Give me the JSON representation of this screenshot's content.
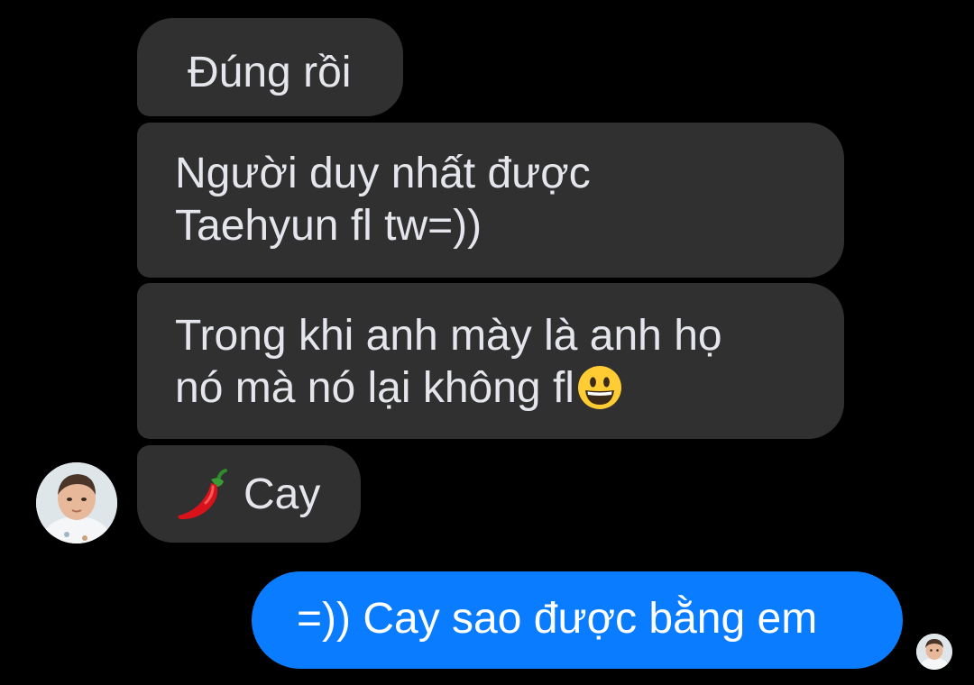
{
  "conversation": {
    "messages": [
      {
        "sender": "other",
        "text": "Đúng rồi"
      },
      {
        "sender": "other",
        "lines": [
          "Người duy nhất được",
          "Taehyun fl tw=))"
        ]
      },
      {
        "sender": "other",
        "lines": [
          "Trong khi anh mày là anh họ",
          "nó mà nó lại không fl"
        ],
        "trailing_emoji": "grinning-face-icon"
      },
      {
        "sender": "other",
        "leading_emoji": "hot-pepper-icon",
        "text": "Cay"
      },
      {
        "sender": "me",
        "text": "=)) Cay sao được bằng em"
      }
    ]
  },
  "colors": {
    "background": "#000000",
    "incoming_bubble": "#303030",
    "outgoing_bubble": "#0a7cff",
    "incoming_text": "#e4e6eb",
    "outgoing_text": "#ffffff"
  }
}
